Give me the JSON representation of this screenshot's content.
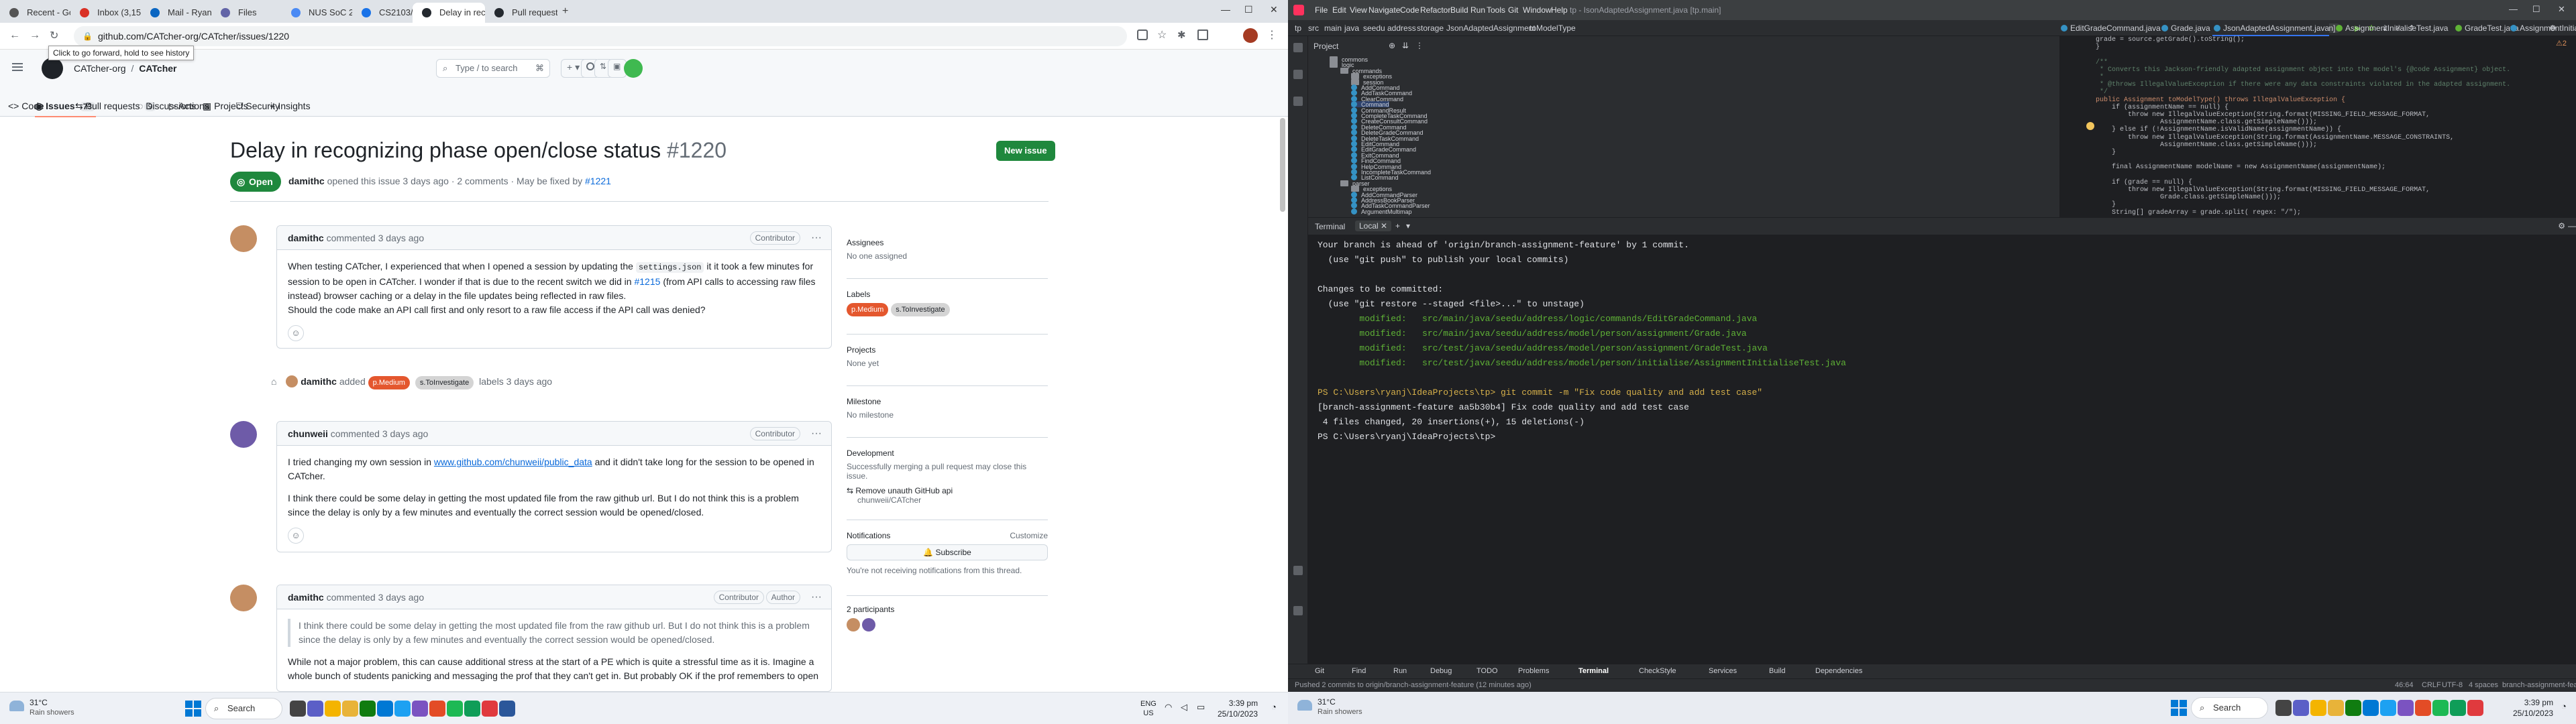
{
  "browser": {
    "tabs": [
      {
        "label": "Recent - Google Drive"
      },
      {
        "label": "Inbox (3,150) - ryanpang..."
      },
      {
        "label": "Mail - Ryan Pang Jin Liang"
      },
      {
        "label": "Files"
      },
      {
        "label": "NUS SoC 22/23 Freshmen"
      },
      {
        "label": "CS2103/T - Week 10 - Pr..."
      },
      {
        "label": "Delay in recognizing pha..."
      },
      {
        "label": "Pull requests - AY2324S1..."
      }
    ],
    "url": "github.com/CATcher-org/CATcher/issues/1220",
    "tooltip": "Click to go forward, hold to see history"
  },
  "github": {
    "breadcrumb_org": "CATcher-org",
    "breadcrumb_sep": "/",
    "breadcrumb_repo": "CATcher",
    "search_placeholder": "Type / to search",
    "nav": {
      "code": "Code",
      "issues": "Issues",
      "issues_count": "73",
      "pulls": "Pull requests",
      "pulls_count": "9",
      "discussions": "Discussions",
      "actions": "Actions",
      "projects": "Projects",
      "security": "Security",
      "insights": "Insights"
    },
    "issue": {
      "title": "Delay in recognizing phase open/close status",
      "number": "#1220",
      "status": "Open",
      "new_issue": "New issue",
      "meta_author": "damithc",
      "meta_text": "opened this issue 3 days ago · 2 comments · May be fixed by",
      "meta_fix": "#1221"
    },
    "comments": [
      {
        "author": "damithc",
        "time": "commented 3 days ago",
        "role": "Contributor",
        "p1a": "When testing CATcher, I experienced that when I opened a session by updating the",
        "p1code": "settings.json",
        "p1b": "it it took a few minutes for session to be open in CATcher. I wonder if that is due to the recent switch we did in",
        "p1link": "#1215",
        "p1c": "(from API calls to accessing raw files instead) browser caching or a delay in the file updates being reflected in raw files.",
        "p2": "Should the code make an API call first and only resort to a raw file access if the API call was denied?"
      },
      {
        "author": "chunweii",
        "time": "commented 3 days ago",
        "role": "Contributor",
        "p1a": "I tried changing my own session in",
        "p1link": "www.github.com/chunweii/public_data",
        "p1b": "and it didn't take long for the session to be opened in CATcher.",
        "p2": "I think there could be some delay in getting the most updated file from the raw github url. But I do not think this is a problem since the delay is only by a few minutes and eventually the correct session would be opened/closed."
      },
      {
        "author": "damithc",
        "time": "commented 3 days ago",
        "role": "Contributor",
        "role2": "Author",
        "quote": "I think there could be some delay in getting the most updated file from the raw github url. But I do not think this is a problem since the delay is only by a few minutes and eventually the correct session would be opened/closed.",
        "p1": "While not a major problem, this can cause additional stress at the start of a PE which is quite a stressful time as it is. Imagine a whole bunch of students panicking and messaging the prof that they can't get in. But probably OK if the prof remembers to open"
      }
    ],
    "event": {
      "actor": "damithc",
      "action": "added",
      "label1": "p.Medium",
      "label2": "s.ToInvestigate",
      "suffix": "labels 3 days ago"
    },
    "sidebar": {
      "assignees_title": "Assignees",
      "assignees_value": "No one assigned",
      "labels_title": "Labels",
      "label1": "p.Medium",
      "label2": "s.ToInvestigate",
      "projects_title": "Projects",
      "projects_value": "None yet",
      "milestone_title": "Milestone",
      "milestone_value": "No milestone",
      "development_title": "Development",
      "development_text": "Successfully merging a pull request may close this issue.",
      "development_pr": "Remove unauth GitHub api",
      "development_repo": "chunweii/CATcher",
      "notifications_title": "Notifications",
      "customize": "Customize",
      "subscribe": "Subscribe",
      "notif_text": "You're not receiving notifications from this thread.",
      "participants": "2 participants"
    },
    "colors": {
      "label_medium": "#e4572e",
      "label_investigate": "#d4d4d4",
      "open_green": "#1f883d"
    }
  },
  "taskbar_left": {
    "weather_temp": "31°C",
    "weather_desc": "Rain showers",
    "search": "Search",
    "lang1": "ENG",
    "lang2": "US",
    "time": "3:39 pm",
    "date": "25/10/2023"
  },
  "ide": {
    "title": "tp - IsonAdaptedAssignment.java [tp.main]",
    "menu": [
      "File",
      "Edit",
      "View",
      "Navigate",
      "Code",
      "Refactor",
      "Build",
      "Run",
      "Tools",
      "Git",
      "Window",
      "Help"
    ],
    "breadcrumbs": [
      "tp",
      "src",
      "main",
      "java",
      "seedu",
      "address",
      "storage",
      "JsonAdaptedAssignment",
      "toModelType"
    ],
    "run_config": "tp [run]",
    "project_label": "Project",
    "tabs": [
      {
        "label": "EditGradeCommand.java"
      },
      {
        "label": "Grade.java"
      },
      {
        "label": "JsonAdaptedAssignment.java"
      },
      {
        "label": "AssignmentInitialiseTest.java"
      },
      {
        "label": "GradeTest.java"
      },
      {
        "label": "AssignmentInitialise.java"
      }
    ],
    "tree": [
      {
        "label": "commons",
        "kind": "folder",
        "level": 2
      },
      {
        "label": "logic",
        "kind": "folder",
        "level": 2
      },
      {
        "label": "commands",
        "kind": "folder",
        "level": 3
      },
      {
        "label": "exceptions",
        "kind": "folder",
        "level": 4
      },
      {
        "label": "session",
        "kind": "folder",
        "level": 4
      },
      {
        "label": "AddCommand",
        "kind": "class",
        "level": 4
      },
      {
        "label": "AddTaskCommand",
        "kind": "class",
        "level": 4
      },
      {
        "label": "ClearCommand",
        "kind": "class",
        "level": 4
      },
      {
        "label": "Command",
        "kind": "class",
        "level": 4
      },
      {
        "label": "CommandResult",
        "kind": "class",
        "level": 4
      },
      {
        "label": "CompleteTaskCommand",
        "kind": "class",
        "level": 4
      },
      {
        "label": "CreateConsultCommand",
        "kind": "class",
        "level": 4
      },
      {
        "label": "DeleteCommand",
        "kind": "class",
        "level": 4
      },
      {
        "label": "DeleteGradeCommand",
        "kind": "class",
        "level": 4
      },
      {
        "label": "DeleteTaskCommand",
        "kind": "class",
        "level": 4
      },
      {
        "label": "EditCommand",
        "kind": "class",
        "level": 4
      },
      {
        "label": "EditGradeCommand",
        "kind": "class",
        "level": 4
      },
      {
        "label": "ExitCommand",
        "kind": "class",
        "level": 4
      },
      {
        "label": "FindCommand",
        "kind": "class",
        "level": 4
      },
      {
        "label": "HelpCommand",
        "kind": "class",
        "level": 4
      },
      {
        "label": "IncompleteTaskCommand",
        "kind": "class",
        "level": 4
      },
      {
        "label": "ListCommand",
        "kind": "class",
        "level": 4
      },
      {
        "label": "parser",
        "kind": "folder",
        "level": 3
      },
      {
        "label": "exceptions",
        "kind": "folder",
        "level": 4
      },
      {
        "label": "AddCommandParser",
        "kind": "class",
        "level": 4
      },
      {
        "label": "AddressBookParser",
        "kind": "class",
        "level": 4
      },
      {
        "label": "AddTaskCommandParser",
        "kind": "class",
        "level": 4
      },
      {
        "label": "ArgumentMultimap",
        "kind": "class",
        "level": 4
      }
    ],
    "editor_lines": [
      "grade = source.getGrade().toString();",
      "}",
      "",
      "/**",
      " * Converts this Jackson-friendly adapted assignment object into the model's {@code Assignment} object.",
      " *",
      " * @throws IllegalValueException if there were any data constraints violated in the adapted assignment.",
      " */",
      "public Assignment toModelType() throws IllegalValueException {",
      "    if (assignmentName == null) {",
      "        throw new IllegalValueException(String.format(MISSING_FIELD_MESSAGE_FORMAT,",
      "                AssignmentName.class.getSimpleName()));",
      "    } else if (!AssignmentName.isValidName(assignmentName)) {",
      "        throw new IllegalValueException(String.format(AssignmentName.MESSAGE_CONSTRAINTS,",
      "                AssignmentName.class.getSimpleName()));",
      "    }",
      "",
      "    final AssignmentName modelName = new AssignmentName(assignmentName);",
      "",
      "    if (grade == null) {",
      "        throw new IllegalValueException(String.format(MISSING_FIELD_MESSAGE_FORMAT,",
      "                Grade.class.getSimpleName()));",
      "    }",
      "    String[] gradeArray = grade.split( regex: \"/\");"
    ],
    "usage_hint": "1 usage",
    "terminal_tab": "Terminal",
    "terminal_local": "Local",
    "terminal_lines": [
      "Your branch is ahead of 'origin/branch-assignment-feature' by 1 commit.",
      "  (use \"git push\" to publish your local commits)",
      "",
      "Changes to be committed:",
      "  (use \"git restore --staged <file>...\" to unstage)",
      "        modified:   src/main/java/seedu/address/logic/commands/EditGradeCommand.java",
      "        modified:   src/main/java/seedu/address/model/person/assignment/Grade.java",
      "        modified:   src/test/java/seedu/address/model/person/assignment/GradeTest.java",
      "        modified:   src/test/java/seedu/address/model/person/initialise/AssignmentInitialiseTest.java",
      "",
      "PS C:\\Users\\ryanj\\IdeaProjects\\tp> git commit -m \"Fix code quality and add test case\"",
      "[branch-assignment-feature aa5b30b4] Fix code quality and add test case",
      " 4 files changed, 20 insertions(+), 15 deletions(-)",
      "PS C:\\Users\\ryanj\\IdeaProjects\\tp> "
    ],
    "bottom_tabs": [
      "Git",
      "Find",
      "Run",
      "Debug",
      "TODO",
      "Problems",
      "Terminal",
      "CheckStyle",
      "Services",
      "Build",
      "Dependencies"
    ],
    "status_left": "Pushed 2 commits to origin/branch-assignment-feature (12 minutes ago)",
    "status_right": [
      "46:64",
      "CRLF",
      "UTF-8",
      "4 spaces",
      "branch-assignment-feature"
    ]
  },
  "taskbar_right": {
    "weather_temp": "31°C",
    "weather_desc": "Rain showers",
    "search": "Search",
    "time": "3:39 pm",
    "date": "25/10/2023"
  }
}
